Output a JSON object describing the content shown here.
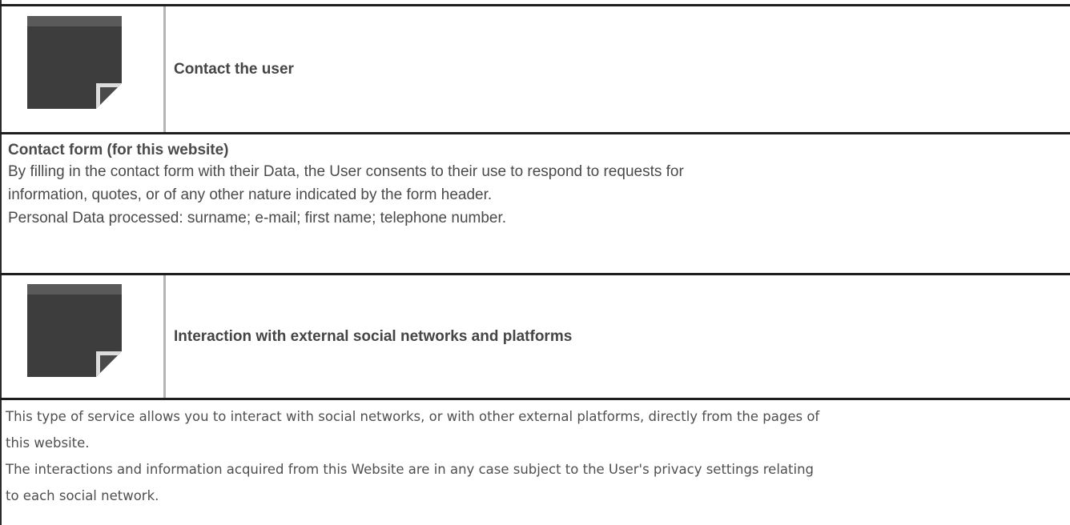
{
  "sections": [
    {
      "icon": "note-icon",
      "title": "Contact the user",
      "subheading": "Contact form (for this website)",
      "paragraph_lines": [
        "By filling in the contact form with their Data, the User consents to their use to respond to requests for",
        "information, quotes, or of any other nature indicated by the form header.",
        "Personal Data processed: surname; e-mail; first name; telephone number."
      ]
    },
    {
      "icon": "note-icon",
      "title": "Interaction with external social networks and platforms",
      "paragraph_lines": [
        "This type of service allows you to interact with social networks, or with other external platforms, directly from the pages of",
        "this website.",
        "The interactions and information acquired from this Website are in any case subject to the User's privacy settings relating",
        "to each social network."
      ]
    }
  ],
  "colors": {
    "icon_body": "#3d3d3d",
    "icon_band": "#5a5a5a",
    "border_dark": "#1e1e1e",
    "border_light": "#b5b5b5"
  }
}
